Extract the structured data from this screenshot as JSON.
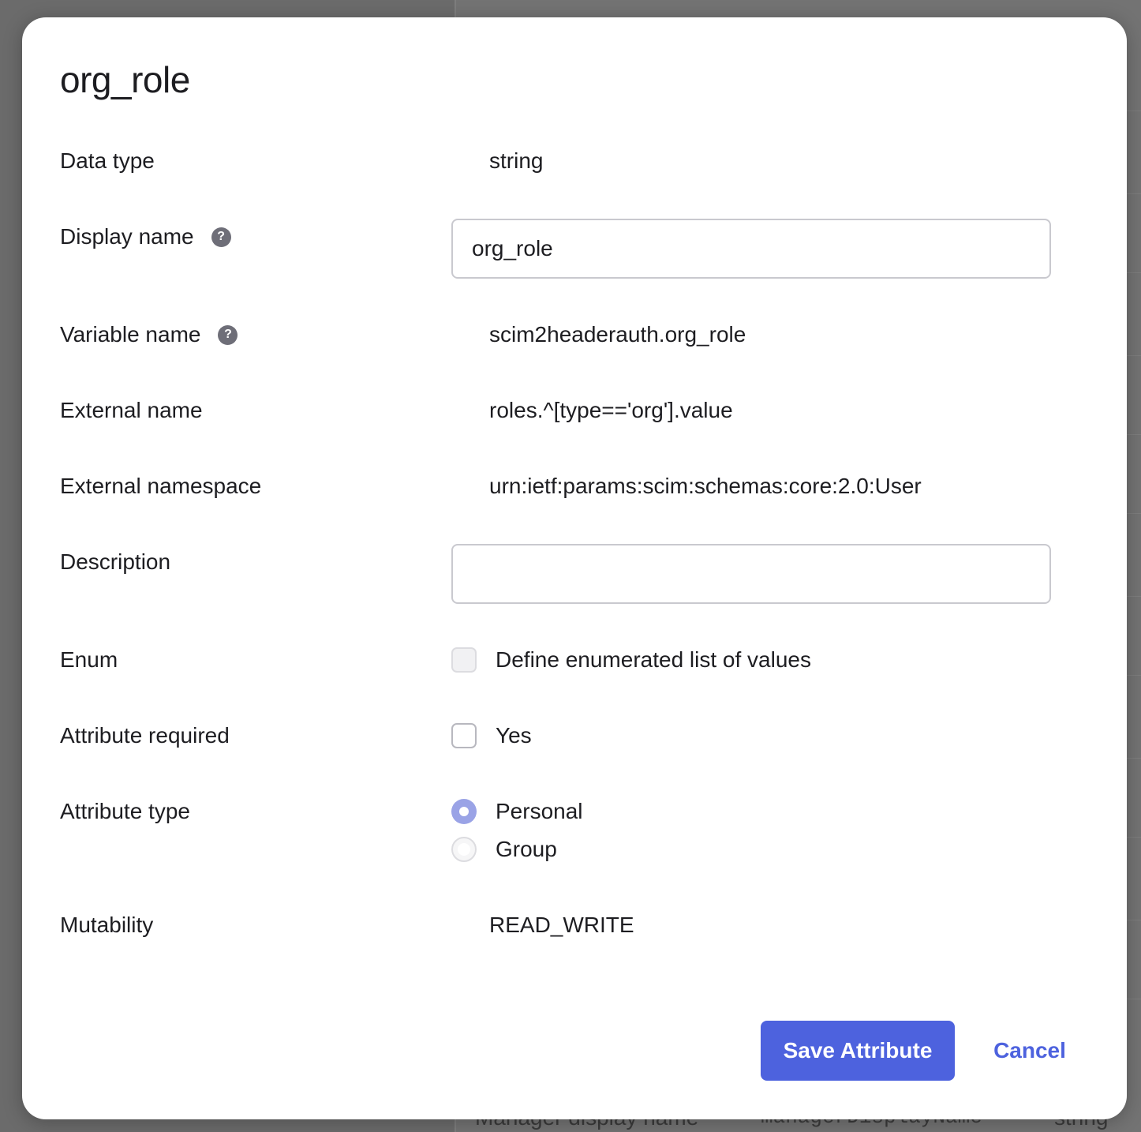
{
  "background": {
    "row_cells": [
      "Manager display name",
      "managerDisplayName",
      "string"
    ]
  },
  "dialog": {
    "title": "org_role",
    "fields": {
      "data_type": {
        "label": "Data type",
        "value": "string"
      },
      "display_name": {
        "label": "Display name",
        "value": "org_role"
      },
      "variable_name": {
        "label": "Variable name",
        "value": "scim2headerauth.org_role"
      },
      "external_name": {
        "label": "External name",
        "value": "roles.^[type=='org'].value"
      },
      "external_namespace": {
        "label": "External namespace",
        "value": "urn:ietf:params:scim:schemas:core:2.0:User"
      },
      "description": {
        "label": "Description",
        "value": ""
      },
      "enum": {
        "label": "Enum",
        "option": "Define enumerated list of values",
        "checked": false,
        "disabled": true
      },
      "attribute_required": {
        "label": "Attribute required",
        "option": "Yes",
        "checked": false
      },
      "attribute_type": {
        "label": "Attribute type",
        "options": [
          {
            "label": "Personal",
            "selected": true
          },
          {
            "label": "Group",
            "selected": false
          }
        ]
      },
      "mutability": {
        "label": "Mutability",
        "value": "READ_WRITE"
      }
    },
    "actions": {
      "save_label": "Save Attribute",
      "cancel_label": "Cancel"
    },
    "colors": {
      "primary": "#4d62de",
      "radio_selected": "#9aa3e6"
    }
  }
}
